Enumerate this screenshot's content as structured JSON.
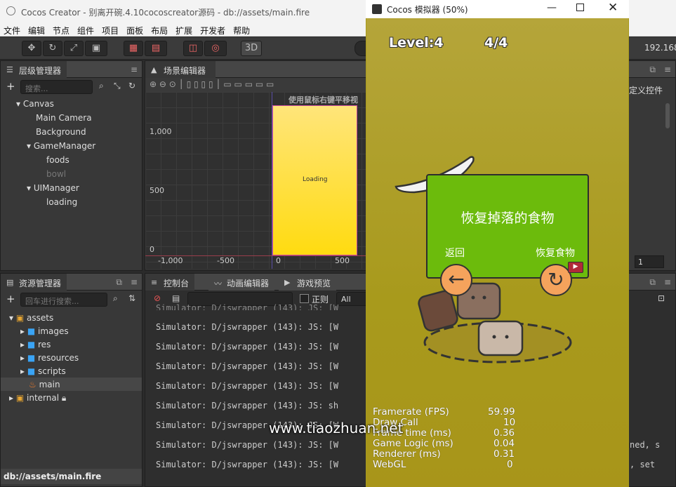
{
  "app": {
    "title": "Cocos Creator - 别离开碗.4.10cocoscreator源码 - db://assets/main.fire",
    "ip": "192.168."
  },
  "menu": [
    "文件",
    "编辑",
    "节点",
    "组件",
    "项目",
    "面板",
    "布局",
    "扩展",
    "开发者",
    "帮助"
  ],
  "toolbar": {
    "btn_3d": "3D"
  },
  "hierarchy": {
    "title": "层级管理器",
    "search_placeholder": "搜索...",
    "nodes": [
      {
        "label": "Canvas",
        "expanded": true
      },
      {
        "label": "Main Camera"
      },
      {
        "label": "Background"
      },
      {
        "label": "GameManager",
        "expanded": true
      },
      {
        "label": "foods"
      },
      {
        "label": "bowl",
        "dim": true
      },
      {
        "label": "UIManager",
        "expanded": true
      },
      {
        "label": "loading"
      }
    ]
  },
  "scene": {
    "title": "场景编辑器",
    "hint": "使用鼠标右键平移视",
    "loading_text": "Loading",
    "y_ticks": [
      "1,000",
      "500",
      "0"
    ],
    "x_ticks": [
      "-1,000",
      "-500",
      "0",
      "500"
    ]
  },
  "inspector": {
    "title": "定义控件",
    "value": "1"
  },
  "assets": {
    "title": "资源管理器",
    "search_placeholder": "回车进行搜索...",
    "items": [
      {
        "label": "assets",
        "type": "folder-root"
      },
      {
        "label": "images",
        "type": "folder"
      },
      {
        "label": "res",
        "type": "folder"
      },
      {
        "label": "resources",
        "type": "folder"
      },
      {
        "label": "scripts",
        "type": "folder"
      },
      {
        "label": "main",
        "type": "scene"
      },
      {
        "label": "internal",
        "type": "folder-root-locked"
      }
    ],
    "path": "db://assets/main.fire"
  },
  "console": {
    "tabs": [
      "控制台",
      "动画编辑器",
      "游戏预览"
    ],
    "regex_label": "正则",
    "level": "All",
    "lines": [
      "Simulator: D/jswrapper (143): JS: [W",
      "Simulator: D/jswrapper (143): JS: [W",
      "Simulator: D/jswrapper (143): JS: [W",
      "Simulator: D/jswrapper (143): JS: [W",
      "Simulator: D/jswrapper (143): JS: sh",
      "Simulator: D/jswrapper (143): JS: [W",
      "Simulator: D/jswrapper (143): JS: [W",
      "Simulator: D/jswrapper (143): JS: [W"
    ],
    "tail1": "ned, s",
    "tail2": ", set",
    "top_partial": "Simulator: D/jswrapper (143): JS: [W"
  },
  "simulator": {
    "title": "Cocos 模拟器 (50%)",
    "level": "Level:4",
    "progress": "4/4",
    "dialog": {
      "title": "恢复掉落的食物",
      "back": "返回",
      "restore": "恢复食物"
    },
    "stats": [
      {
        "label": "Framerate (FPS)",
        "value": "59.99"
      },
      {
        "label": "Draw Call",
        "value": "10"
      },
      {
        "label": "Frame time (ms)",
        "value": "0.36"
      },
      {
        "label": "Game Logic (ms)",
        "value": "0.04"
      },
      {
        "label": "Renderer (ms)",
        "value": "0.31"
      },
      {
        "label": "WebGL",
        "value": "0"
      }
    ],
    "watermark": "www.tiaozhuan.net"
  },
  "colors": {
    "dialog": "#6cbb0c",
    "button": "#f5a35c",
    "scene_rect_top": "#ffe57a",
    "scene_rect_bottom": "#ffdb10"
  }
}
